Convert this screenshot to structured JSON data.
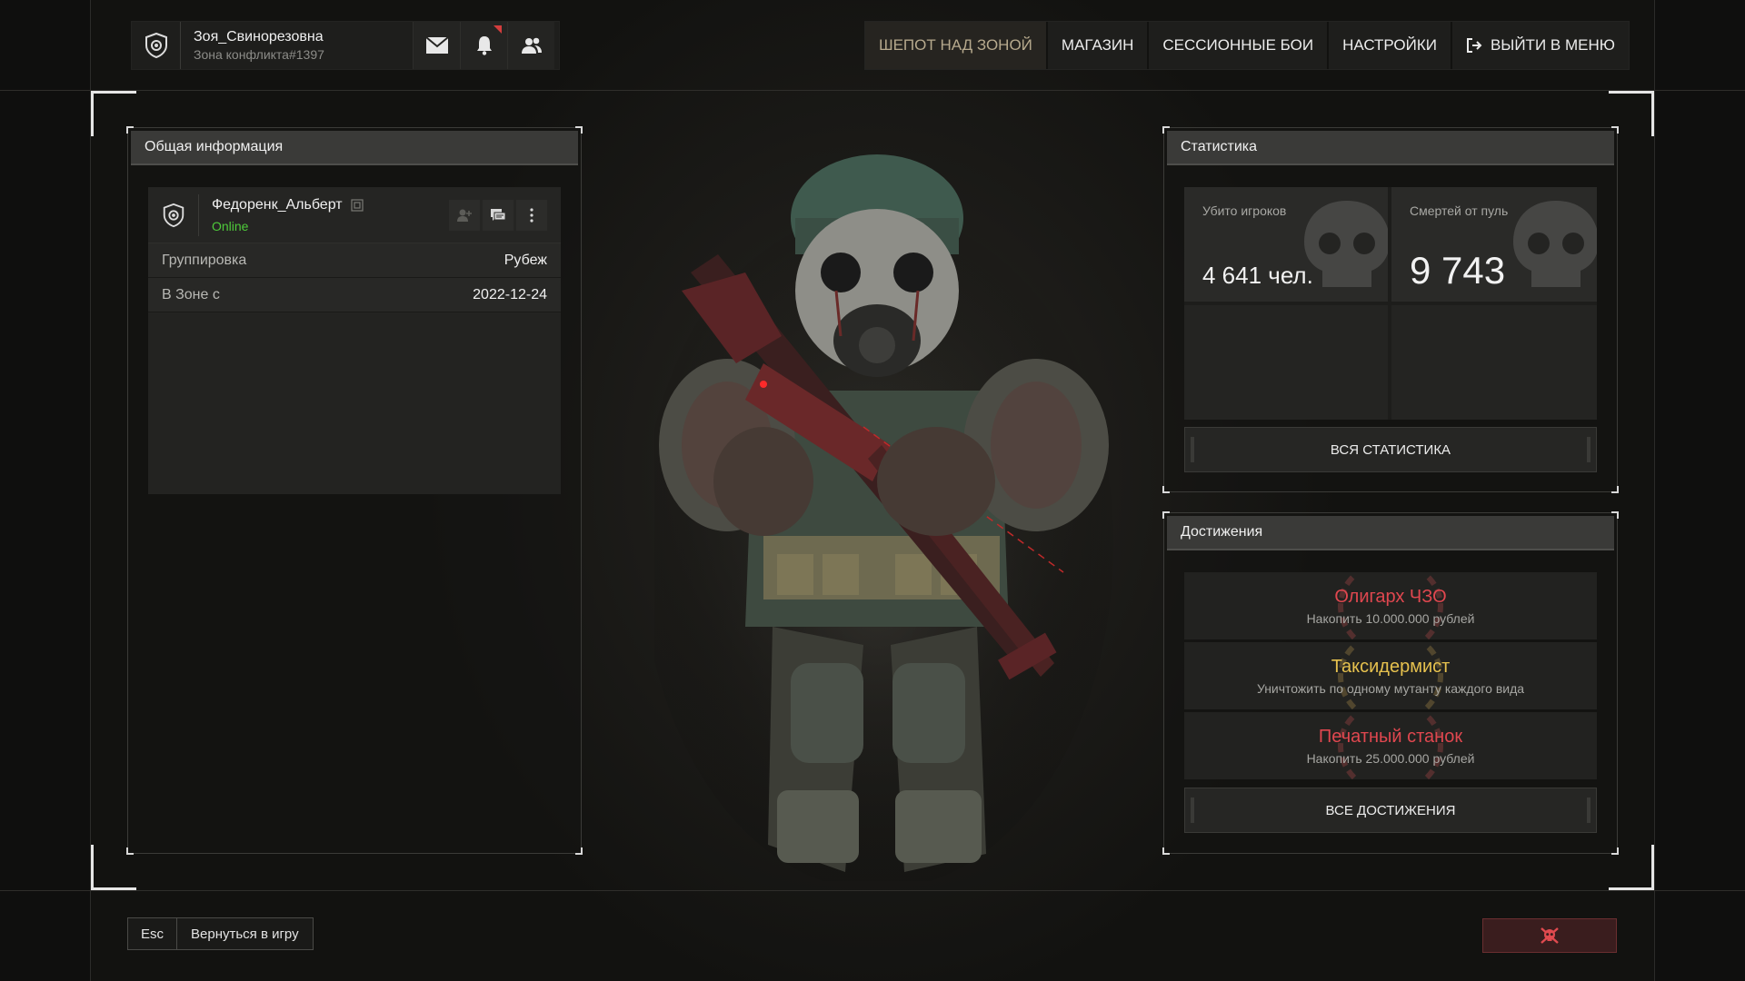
{
  "player": {
    "name": "Зоя_Свинорезовна",
    "zone": "Зона конфликта#1397"
  },
  "topbar_icons": [
    "shield-emblem-icon",
    "mail-icon",
    "bell-icon",
    "friends-icon"
  ],
  "nav": {
    "items": [
      "ШЕПОТ НАД ЗОНОЙ",
      "МАГАЗИН",
      "СЕССИОННЫЕ БОИ",
      "НАСТРОЙКИ"
    ],
    "exit_label": "ВЫЙТИ В МЕНЮ"
  },
  "general": {
    "title": "Общая информация",
    "user": {
      "name": "Федоренк_Альберт",
      "status": "Online"
    },
    "rows": [
      {
        "key": "Группировка",
        "value": "Рубеж"
      },
      {
        "key": "В Зоне с",
        "value": "2022-12-24"
      }
    ]
  },
  "stats": {
    "title": "Статистика",
    "kills_label": "Убито игроков",
    "kills_value": "4 641 чел.",
    "deaths_label": "Смертей от пуль",
    "deaths_value": "9 743",
    "all_button": "ВСЯ СТАТИСТИКА"
  },
  "achievements": {
    "title": "Достижения",
    "items": [
      {
        "title": "Олигарх ЧЗО",
        "desc": "Накопить 10.000.000 рублей",
        "color": "#e0474f"
      },
      {
        "title": "Таксидермист",
        "desc": "Уничтожить по одному мутанту каждого вида",
        "color": "#e6c14e"
      },
      {
        "title": "Печатный станок",
        "desc": "Накопить 25.000.000 рублей",
        "color": "#e0474f"
      }
    ],
    "all_button": "ВСЕ ДОСТИЖЕНИЯ"
  },
  "footer": {
    "esc_key": "Esc",
    "back_label": "Вернуться в игру"
  },
  "colors": {
    "online": "#4ecb3a",
    "danger": "#e0474f",
    "accent_nav": "#b6a98d"
  }
}
